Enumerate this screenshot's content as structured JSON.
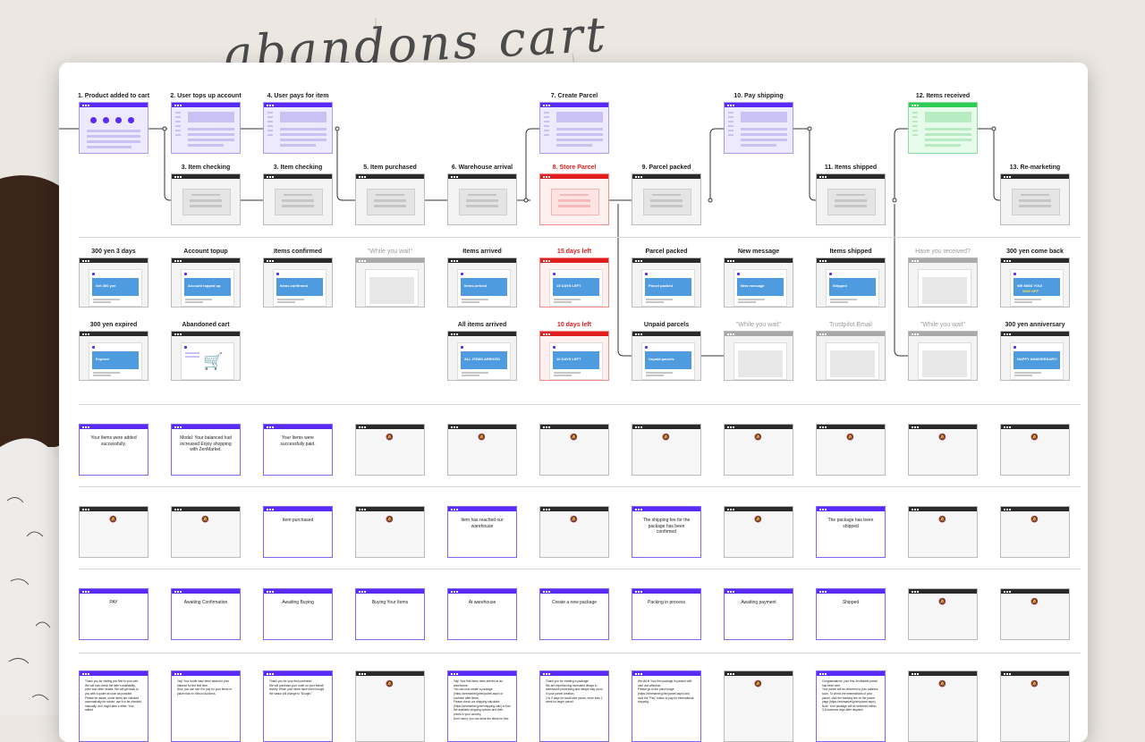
{
  "background": {
    "handwriting": "abandons cart"
  },
  "row1": [
    {
      "label": "1. Product added to cart",
      "variant": "product"
    },
    {
      "label": "2. User tops up account",
      "variant": "form"
    },
    {
      "label": "4. User pays for item",
      "variant": "form"
    },
    {
      "label": "7. Create Parcel",
      "variant": "form"
    },
    {
      "label": "10. Pay shipping",
      "variant": "form"
    },
    {
      "label": "12. Items received",
      "variant": "green"
    }
  ],
  "row2": [
    {
      "label": "3. Item checking"
    },
    {
      "label": "3. Item checking"
    },
    {
      "label": "5. Item purchased"
    },
    {
      "label": "6. Warehouse arrival"
    },
    {
      "label": "8. Store Parcel",
      "red": true
    },
    {
      "label": "9. Parcel packed"
    },
    {
      "label": "11. Items shipped"
    },
    {
      "label": "13. Re-marketing"
    }
  ],
  "emails_row1": [
    {
      "label": "300 yen 3 days",
      "image_text": "Get 300 yen"
    },
    {
      "label": "Account topup",
      "image_text": "Account topped up"
    },
    {
      "label": "Items confirmed",
      "image_text": "Items confirmed"
    },
    {
      "label": "\"While you wait\"",
      "muted": true
    },
    {
      "label": "Items arrived",
      "image_text": "Items arrived"
    },
    {
      "label": "15 days left",
      "red": true,
      "image_text": "15 DAYS LEFT"
    },
    {
      "label": "Parcel packed",
      "image_text": "Parcel packed"
    },
    {
      "label": "New message",
      "image_text": "New message"
    },
    {
      "label": "Items shipped",
      "image_text": "Shipped"
    },
    {
      "label": "Have you received?",
      "muted": true
    },
    {
      "label": "300 yen come back",
      "image_text": "WE MISS YOU!",
      "image_sub": "¥300 OFF"
    }
  ],
  "emails_row2": [
    {
      "label": "300 yen expired",
      "image_text": "Expired"
    },
    {
      "label": "Abandoned cart",
      "cart": true
    },
    {
      "label": "All items arrived",
      "image_text": "ALL ITEMS ARRIVED"
    },
    {
      "label": "10 days left",
      "red": true,
      "image_text": "10 DAYS LEFT"
    },
    {
      "label": "Unpaid parcels",
      "image_text": "Unpaid parcels"
    },
    {
      "label": "\"While you wait\"",
      "muted": true
    },
    {
      "label": "Trustpilot Email",
      "muted": true
    },
    {
      "label": "\"While you wait\"",
      "muted": true
    },
    {
      "label": "300 yen anniversary",
      "image_text": "HAPPY ANNIVERSARY!"
    }
  ],
  "notif_row1": [
    "Your Items were added successfully.",
    "Modal: Your balanced had increased Enjoy shopping with ZenMarket.",
    "Your Items were successfully paid.",
    "",
    "",
    "",
    "",
    "",
    "",
    "",
    ""
  ],
  "notif_row2": [
    "",
    "",
    "Item purchased",
    "",
    "Item has reached our warehouse",
    "",
    "The shipping fee for the package has been confirmed",
    "",
    "The package has been shipped",
    "",
    ""
  ],
  "status_row": [
    "PAY",
    "Awaiting Confirmation",
    "Awaiting Buying",
    "Buying Your Items",
    "At warehouse",
    "Create a new package",
    "Packing in process",
    "Awaiting payment",
    "Shipped",
    "",
    ""
  ],
  "message_row": [
    "Thank you for visiting you first to your cart.\nWe will now check the item's availability, price and other details. We will get back to you with a quote as soon as possible.\nPlease be aware, some items are checked automatically for robots, use it to be checked manually, as it might take a while. Your added",
    "Yay! Your funds have been added to your balance for the first time.\nNow, you can use it to pay for your items or place bids on Yahoo! Auctions.",
    "Thank you for your first purchase!\nWe will purchase your order on your behalf shortly. When your items have been bought the status will change to \"Bought.\"",
    "",
    "Yay! Your first items have arrived at our warehouse.\nYou can now create a package (https://zenmarket.jp/en/parcel.aspx) or continue after items.\nPlease check our shipping calculator (https://zenmarket.jp/en/shipping-calc) to find the available shipping options and their prices in your country.\nDon't worry, you can store the items for free",
    "Thank you for creating a package!\nWe are experiencing increased delays in warehouse processing and delays may occur in your parcel creation.\n2 to 5 days for small-size parcel, more than 1 week for larger parcel.",
    "We did it! Your first package is packed with care and affection.\nPlease go to the parcel page (https://zenmarket.jp/en/parcel.aspx) and click the \"Pay\" button to pay for international shipping.",
    "",
    "Congratulations, your first ZenMarket parcel has been sent.\nYour parcel will be delivered to your address soon. To check the whereabouts of your parcel, click the tracking link on the parcel page (https://zenmarket.jp/en/parcel.aspx).\nNote: Your package will be delivered within 3-5 business days after dispatch",
    "",
    ""
  ],
  "colors": {
    "accent": "#5a2bf5",
    "alert": "#e01e1e",
    "success": "#2ecc55",
    "email_image": "#4e9be0"
  },
  "icons": {
    "empty_notification": "bell-slash-icon",
    "cart": "shopping-cart-icon"
  }
}
